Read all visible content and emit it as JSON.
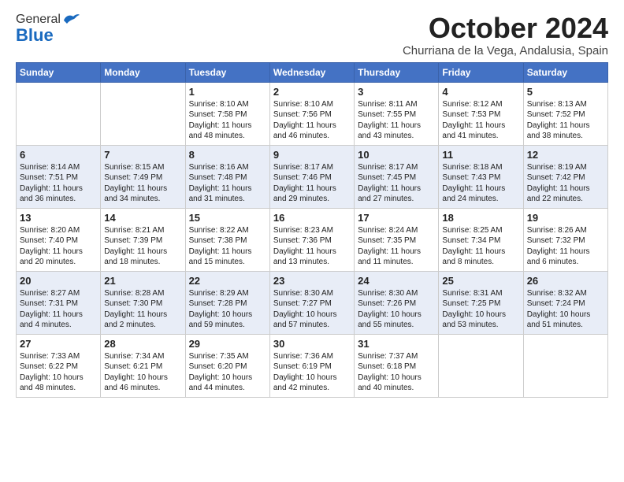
{
  "header": {
    "logo_general": "General",
    "logo_blue": "Blue",
    "month_title": "October 2024",
    "subtitle": "Churriana de la Vega, Andalusia, Spain"
  },
  "days_of_week": [
    "Sunday",
    "Monday",
    "Tuesday",
    "Wednesday",
    "Thursday",
    "Friday",
    "Saturday"
  ],
  "weeks": [
    [
      {
        "day": "",
        "content": ""
      },
      {
        "day": "",
        "content": ""
      },
      {
        "day": "1",
        "content": "Sunrise: 8:10 AM\nSunset: 7:58 PM\nDaylight: 11 hours and 48 minutes."
      },
      {
        "day": "2",
        "content": "Sunrise: 8:10 AM\nSunset: 7:56 PM\nDaylight: 11 hours and 46 minutes."
      },
      {
        "day": "3",
        "content": "Sunrise: 8:11 AM\nSunset: 7:55 PM\nDaylight: 11 hours and 43 minutes."
      },
      {
        "day": "4",
        "content": "Sunrise: 8:12 AM\nSunset: 7:53 PM\nDaylight: 11 hours and 41 minutes."
      },
      {
        "day": "5",
        "content": "Sunrise: 8:13 AM\nSunset: 7:52 PM\nDaylight: 11 hours and 38 minutes."
      }
    ],
    [
      {
        "day": "6",
        "content": "Sunrise: 8:14 AM\nSunset: 7:51 PM\nDaylight: 11 hours and 36 minutes."
      },
      {
        "day": "7",
        "content": "Sunrise: 8:15 AM\nSunset: 7:49 PM\nDaylight: 11 hours and 34 minutes."
      },
      {
        "day": "8",
        "content": "Sunrise: 8:16 AM\nSunset: 7:48 PM\nDaylight: 11 hours and 31 minutes."
      },
      {
        "day": "9",
        "content": "Sunrise: 8:17 AM\nSunset: 7:46 PM\nDaylight: 11 hours and 29 minutes."
      },
      {
        "day": "10",
        "content": "Sunrise: 8:17 AM\nSunset: 7:45 PM\nDaylight: 11 hours and 27 minutes."
      },
      {
        "day": "11",
        "content": "Sunrise: 8:18 AM\nSunset: 7:43 PM\nDaylight: 11 hours and 24 minutes."
      },
      {
        "day": "12",
        "content": "Sunrise: 8:19 AM\nSunset: 7:42 PM\nDaylight: 11 hours and 22 minutes."
      }
    ],
    [
      {
        "day": "13",
        "content": "Sunrise: 8:20 AM\nSunset: 7:40 PM\nDaylight: 11 hours and 20 minutes."
      },
      {
        "day": "14",
        "content": "Sunrise: 8:21 AM\nSunset: 7:39 PM\nDaylight: 11 hours and 18 minutes."
      },
      {
        "day": "15",
        "content": "Sunrise: 8:22 AM\nSunset: 7:38 PM\nDaylight: 11 hours and 15 minutes."
      },
      {
        "day": "16",
        "content": "Sunrise: 8:23 AM\nSunset: 7:36 PM\nDaylight: 11 hours and 13 minutes."
      },
      {
        "day": "17",
        "content": "Sunrise: 8:24 AM\nSunset: 7:35 PM\nDaylight: 11 hours and 11 minutes."
      },
      {
        "day": "18",
        "content": "Sunrise: 8:25 AM\nSunset: 7:34 PM\nDaylight: 11 hours and 8 minutes."
      },
      {
        "day": "19",
        "content": "Sunrise: 8:26 AM\nSunset: 7:32 PM\nDaylight: 11 hours and 6 minutes."
      }
    ],
    [
      {
        "day": "20",
        "content": "Sunrise: 8:27 AM\nSunset: 7:31 PM\nDaylight: 11 hours and 4 minutes."
      },
      {
        "day": "21",
        "content": "Sunrise: 8:28 AM\nSunset: 7:30 PM\nDaylight: 11 hours and 2 minutes."
      },
      {
        "day": "22",
        "content": "Sunrise: 8:29 AM\nSunset: 7:28 PM\nDaylight: 10 hours and 59 minutes."
      },
      {
        "day": "23",
        "content": "Sunrise: 8:30 AM\nSunset: 7:27 PM\nDaylight: 10 hours and 57 minutes."
      },
      {
        "day": "24",
        "content": "Sunrise: 8:30 AM\nSunset: 7:26 PM\nDaylight: 10 hours and 55 minutes."
      },
      {
        "day": "25",
        "content": "Sunrise: 8:31 AM\nSunset: 7:25 PM\nDaylight: 10 hours and 53 minutes."
      },
      {
        "day": "26",
        "content": "Sunrise: 8:32 AM\nSunset: 7:24 PM\nDaylight: 10 hours and 51 minutes."
      }
    ],
    [
      {
        "day": "27",
        "content": "Sunrise: 7:33 AM\nSunset: 6:22 PM\nDaylight: 10 hours and 48 minutes."
      },
      {
        "day": "28",
        "content": "Sunrise: 7:34 AM\nSunset: 6:21 PM\nDaylight: 10 hours and 46 minutes."
      },
      {
        "day": "29",
        "content": "Sunrise: 7:35 AM\nSunset: 6:20 PM\nDaylight: 10 hours and 44 minutes."
      },
      {
        "day": "30",
        "content": "Sunrise: 7:36 AM\nSunset: 6:19 PM\nDaylight: 10 hours and 42 minutes."
      },
      {
        "day": "31",
        "content": "Sunrise: 7:37 AM\nSunset: 6:18 PM\nDaylight: 10 hours and 40 minutes."
      },
      {
        "day": "",
        "content": ""
      },
      {
        "day": "",
        "content": ""
      }
    ]
  ]
}
